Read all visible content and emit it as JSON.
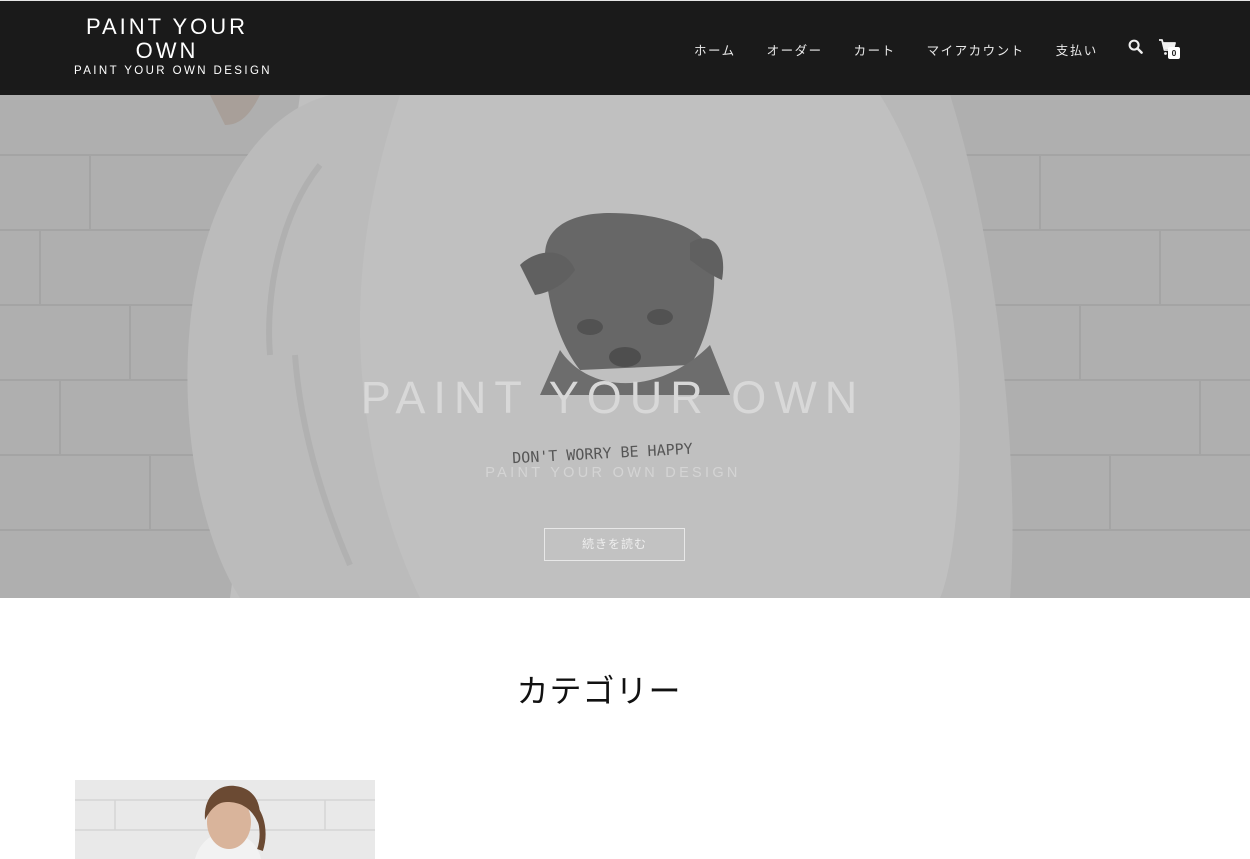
{
  "header": {
    "brand_title": "PAINT YOUR OWN",
    "brand_tagline": "PAINT YOUR OWN DESIGN",
    "nav": [
      "ホーム",
      "オーダー",
      "カート",
      "マイアカウント",
      "支払い"
    ],
    "cart_count": "0",
    "icons": [
      "search-icon",
      "cart-icon"
    ]
  },
  "hero": {
    "title": "PAINT YOUR OWN",
    "subtitle": "PAINT YOUR OWN DESIGN",
    "button_label": "続きを読む",
    "shirt_print_text": "DON'T WORRY BE HAPPY"
  },
  "content": {
    "section_title": "カテゴリー"
  },
  "colors": {
    "header_bg": "#1a1a1a",
    "hero_overlay": "#808080",
    "page_bg": "#ffffff"
  }
}
